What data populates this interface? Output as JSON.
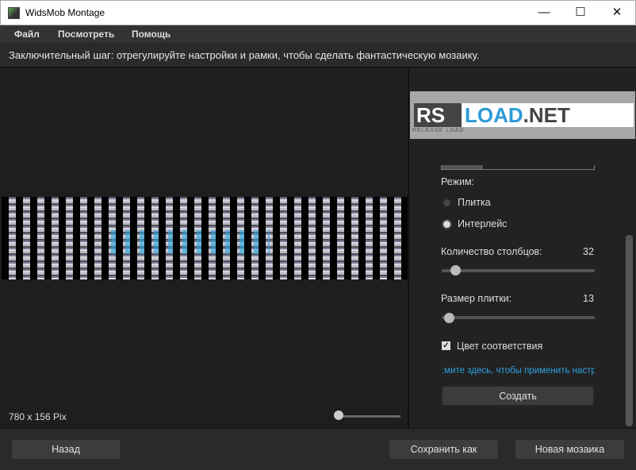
{
  "window": {
    "title": "WidsMob Montage",
    "minimize": "—",
    "maximize": "☐",
    "close": "✕"
  },
  "menu": [
    "Файл",
    "Посмотреть",
    "Помощь"
  ],
  "hint": "Заключительный шаг: отрегулируйте настройки и рамки, чтобы сделать фантастическую мозаику.",
  "preview": {
    "dimensions": "780 x 156 Pix",
    "zoom_fraction": 0.05
  },
  "logo": {
    "rs": "RS",
    "load": "LOAD",
    "dot": ".",
    "net": "NET",
    "sub": "RELEASE LOAD"
  },
  "settings": {
    "mode_label": "Режим:",
    "modes": [
      {
        "label": "Плитка",
        "selected": false
      },
      {
        "label": "Интерлейс",
        "selected": true
      }
    ],
    "columns_label": "Количество столбцов:",
    "columns_value": "32",
    "tile_label": "Размер плитки:",
    "tile_value": "13",
    "color_match_label": "Цвет соответствия",
    "color_match_checked": true,
    "apply_link": ":мите здесь, чтобы применить настрс",
    "create_button": "Создать"
  },
  "footer": {
    "back": "Назад",
    "save_as": "Сохранить как",
    "new_mosaic": "Новая мозаика"
  }
}
